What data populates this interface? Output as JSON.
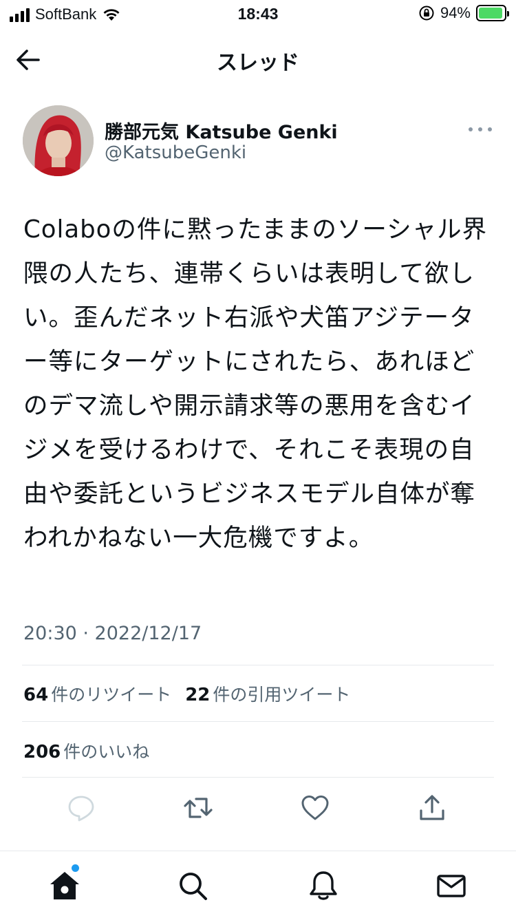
{
  "status_bar": {
    "carrier": "SoftBank",
    "time": "18:43",
    "battery_percent": "94%",
    "battery_level": 0.94,
    "battery_color": "#4cd964"
  },
  "nav": {
    "title": "スレッド",
    "back_icon": "arrow-left-icon"
  },
  "tweet": {
    "author_name": "勝部元気 Katsube Genki",
    "author_handle": "@KatsubeGenki",
    "text": "Colaboの件に黙ったままのソーシャル界隈の人たち、連帯くらいは表明して欲しい。歪んだネット右派や犬笛アジテーター等にターゲットにされたら、あれほどのデマ流しや開示請求等の悪用を含むイジメを受けるわけで、それこそ表現の自由や委託というビジネスモデル自体が奪われかねない一大危機ですよ。",
    "timestamp": "20:30 · 2022/12/17"
  },
  "stats": {
    "retweets_count": "64",
    "retweets_label": "件のリツイート",
    "quotes_count": "22",
    "quotes_label": "件の引用ツイート",
    "likes_count": "206",
    "likes_label": "件のいいね"
  },
  "actions": [
    "reply-icon",
    "retweet-icon",
    "like-icon",
    "share-icon"
  ],
  "tabbar": {
    "tabs": [
      "home-icon",
      "search-icon",
      "notifications-icon",
      "messages-icon"
    ],
    "accent": "#1d9bf0"
  }
}
